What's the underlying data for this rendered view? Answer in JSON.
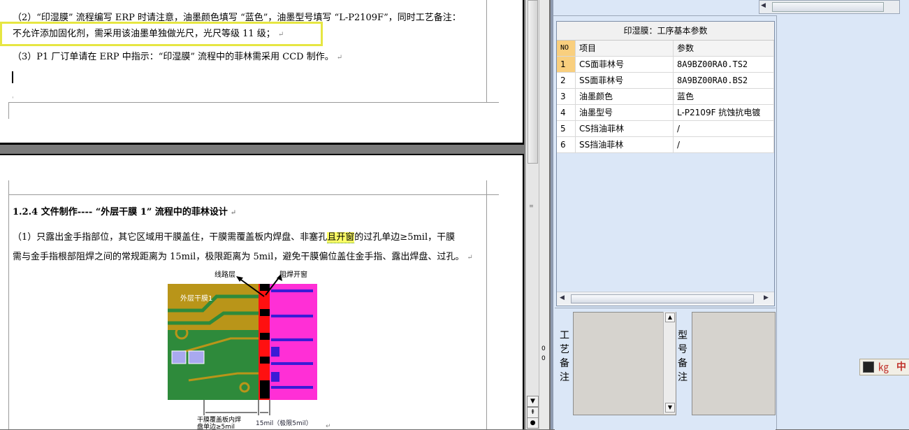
{
  "document": {
    "page1": {
      "line1": "（2）“印湿膜” 流程编写 ERP 时请注意，油墨颜色填写 “蓝色”，油墨型号填写 “L-P2109F”，同时工艺备注：",
      "line2": "不允许添加固化剂，需采用该油墨单独做光尺，光尺等级 11 级；",
      "line3": "（3）P1 厂订单请在 ERP 中指示：“印湿膜” 流程中的菲林需采用 CCD 制作。"
    },
    "page2": {
      "heading": "1.2.4 文件制作---- “外层干膜 1” 流程中的菲林设计",
      "para1_line1_a": "（1）只露出金手指部位，其它区域用干膜盖住，干膜需覆盖板内焊盘、非塞孔",
      "para1_line1_hl": "且开窗",
      "para1_line1_b": "的过孔单边≥5mil，干膜",
      "para1_line2": "需与金手指根部阻焊之间的常规距离为 15mil，极限距离为 5mil，避免干膜偏位盖住金手指、露出焊盘、过孔。",
      "figure": {
        "label_circuit": "线路层",
        "label_solder": "阻焊开窗",
        "label_dryfilm": "外层干膜1",
        "label_bottom_left_1": "干膜覆盖板内焊",
        "label_bottom_left_2": "盘单边≥5mil",
        "label_bottom_right": "15mil（极限5mil）"
      }
    },
    "para_mark": "↵",
    "ruler_marks": [
      "0",
      "0"
    ]
  },
  "app": {
    "grid": {
      "title": "印湿膜：工序基本参数",
      "headers": {
        "no": "NO",
        "item": "项目",
        "value": "参数"
      },
      "rows": [
        {
          "no": "1",
          "item": "CS面菲林号",
          "value": "8A9BZ00RA0.TS2"
        },
        {
          "no": "2",
          "item": "SS面菲林号",
          "value": "8A9BZ00RA0.BS2"
        },
        {
          "no": "3",
          "item": "油墨颜色",
          "value": "蓝色"
        },
        {
          "no": "4",
          "item": "油墨型号",
          "value": "L-P2109F 抗蚀抗电镀"
        },
        {
          "no": "5",
          "item": "CS挡油菲林",
          "value": "/"
        },
        {
          "no": "6",
          "item": "SS挡油菲林",
          "value": "/"
        }
      ]
    },
    "notes": {
      "process_label": "工艺备注",
      "model_label": "型号备注"
    },
    "ime": {
      "text": "中"
    }
  }
}
